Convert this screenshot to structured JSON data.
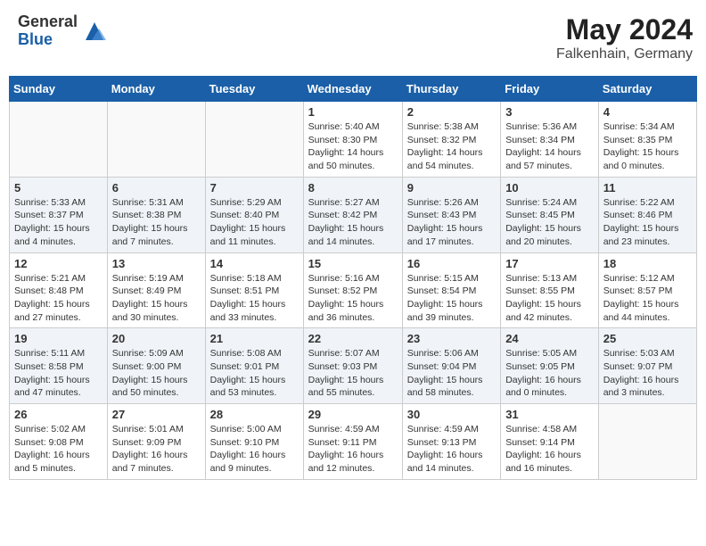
{
  "header": {
    "logo_general": "General",
    "logo_blue": "Blue",
    "month_year": "May 2024",
    "location": "Falkenhain, Germany"
  },
  "weekdays": [
    "Sunday",
    "Monday",
    "Tuesday",
    "Wednesday",
    "Thursday",
    "Friday",
    "Saturday"
  ],
  "weeks": [
    [
      {
        "day": "",
        "text": ""
      },
      {
        "day": "",
        "text": ""
      },
      {
        "day": "",
        "text": ""
      },
      {
        "day": "1",
        "text": "Sunrise: 5:40 AM\nSunset: 8:30 PM\nDaylight: 14 hours\nand 50 minutes."
      },
      {
        "day": "2",
        "text": "Sunrise: 5:38 AM\nSunset: 8:32 PM\nDaylight: 14 hours\nand 54 minutes."
      },
      {
        "day": "3",
        "text": "Sunrise: 5:36 AM\nSunset: 8:34 PM\nDaylight: 14 hours\nand 57 minutes."
      },
      {
        "day": "4",
        "text": "Sunrise: 5:34 AM\nSunset: 8:35 PM\nDaylight: 15 hours\nand 0 minutes."
      }
    ],
    [
      {
        "day": "5",
        "text": "Sunrise: 5:33 AM\nSunset: 8:37 PM\nDaylight: 15 hours\nand 4 minutes."
      },
      {
        "day": "6",
        "text": "Sunrise: 5:31 AM\nSunset: 8:38 PM\nDaylight: 15 hours\nand 7 minutes."
      },
      {
        "day": "7",
        "text": "Sunrise: 5:29 AM\nSunset: 8:40 PM\nDaylight: 15 hours\nand 11 minutes."
      },
      {
        "day": "8",
        "text": "Sunrise: 5:27 AM\nSunset: 8:42 PM\nDaylight: 15 hours\nand 14 minutes."
      },
      {
        "day": "9",
        "text": "Sunrise: 5:26 AM\nSunset: 8:43 PM\nDaylight: 15 hours\nand 17 minutes."
      },
      {
        "day": "10",
        "text": "Sunrise: 5:24 AM\nSunset: 8:45 PM\nDaylight: 15 hours\nand 20 minutes."
      },
      {
        "day": "11",
        "text": "Sunrise: 5:22 AM\nSunset: 8:46 PM\nDaylight: 15 hours\nand 23 minutes."
      }
    ],
    [
      {
        "day": "12",
        "text": "Sunrise: 5:21 AM\nSunset: 8:48 PM\nDaylight: 15 hours\nand 27 minutes."
      },
      {
        "day": "13",
        "text": "Sunrise: 5:19 AM\nSunset: 8:49 PM\nDaylight: 15 hours\nand 30 minutes."
      },
      {
        "day": "14",
        "text": "Sunrise: 5:18 AM\nSunset: 8:51 PM\nDaylight: 15 hours\nand 33 minutes."
      },
      {
        "day": "15",
        "text": "Sunrise: 5:16 AM\nSunset: 8:52 PM\nDaylight: 15 hours\nand 36 minutes."
      },
      {
        "day": "16",
        "text": "Sunrise: 5:15 AM\nSunset: 8:54 PM\nDaylight: 15 hours\nand 39 minutes."
      },
      {
        "day": "17",
        "text": "Sunrise: 5:13 AM\nSunset: 8:55 PM\nDaylight: 15 hours\nand 42 minutes."
      },
      {
        "day": "18",
        "text": "Sunrise: 5:12 AM\nSunset: 8:57 PM\nDaylight: 15 hours\nand 44 minutes."
      }
    ],
    [
      {
        "day": "19",
        "text": "Sunrise: 5:11 AM\nSunset: 8:58 PM\nDaylight: 15 hours\nand 47 minutes."
      },
      {
        "day": "20",
        "text": "Sunrise: 5:09 AM\nSunset: 9:00 PM\nDaylight: 15 hours\nand 50 minutes."
      },
      {
        "day": "21",
        "text": "Sunrise: 5:08 AM\nSunset: 9:01 PM\nDaylight: 15 hours\nand 53 minutes."
      },
      {
        "day": "22",
        "text": "Sunrise: 5:07 AM\nSunset: 9:03 PM\nDaylight: 15 hours\nand 55 minutes."
      },
      {
        "day": "23",
        "text": "Sunrise: 5:06 AM\nSunset: 9:04 PM\nDaylight: 15 hours\nand 58 minutes."
      },
      {
        "day": "24",
        "text": "Sunrise: 5:05 AM\nSunset: 9:05 PM\nDaylight: 16 hours\nand 0 minutes."
      },
      {
        "day": "25",
        "text": "Sunrise: 5:03 AM\nSunset: 9:07 PM\nDaylight: 16 hours\nand 3 minutes."
      }
    ],
    [
      {
        "day": "26",
        "text": "Sunrise: 5:02 AM\nSunset: 9:08 PM\nDaylight: 16 hours\nand 5 minutes."
      },
      {
        "day": "27",
        "text": "Sunrise: 5:01 AM\nSunset: 9:09 PM\nDaylight: 16 hours\nand 7 minutes."
      },
      {
        "day": "28",
        "text": "Sunrise: 5:00 AM\nSunset: 9:10 PM\nDaylight: 16 hours\nand 9 minutes."
      },
      {
        "day": "29",
        "text": "Sunrise: 4:59 AM\nSunset: 9:11 PM\nDaylight: 16 hours\nand 12 minutes."
      },
      {
        "day": "30",
        "text": "Sunrise: 4:59 AM\nSunset: 9:13 PM\nDaylight: 16 hours\nand 14 minutes."
      },
      {
        "day": "31",
        "text": "Sunrise: 4:58 AM\nSunset: 9:14 PM\nDaylight: 16 hours\nand 16 minutes."
      },
      {
        "day": "",
        "text": ""
      }
    ]
  ]
}
